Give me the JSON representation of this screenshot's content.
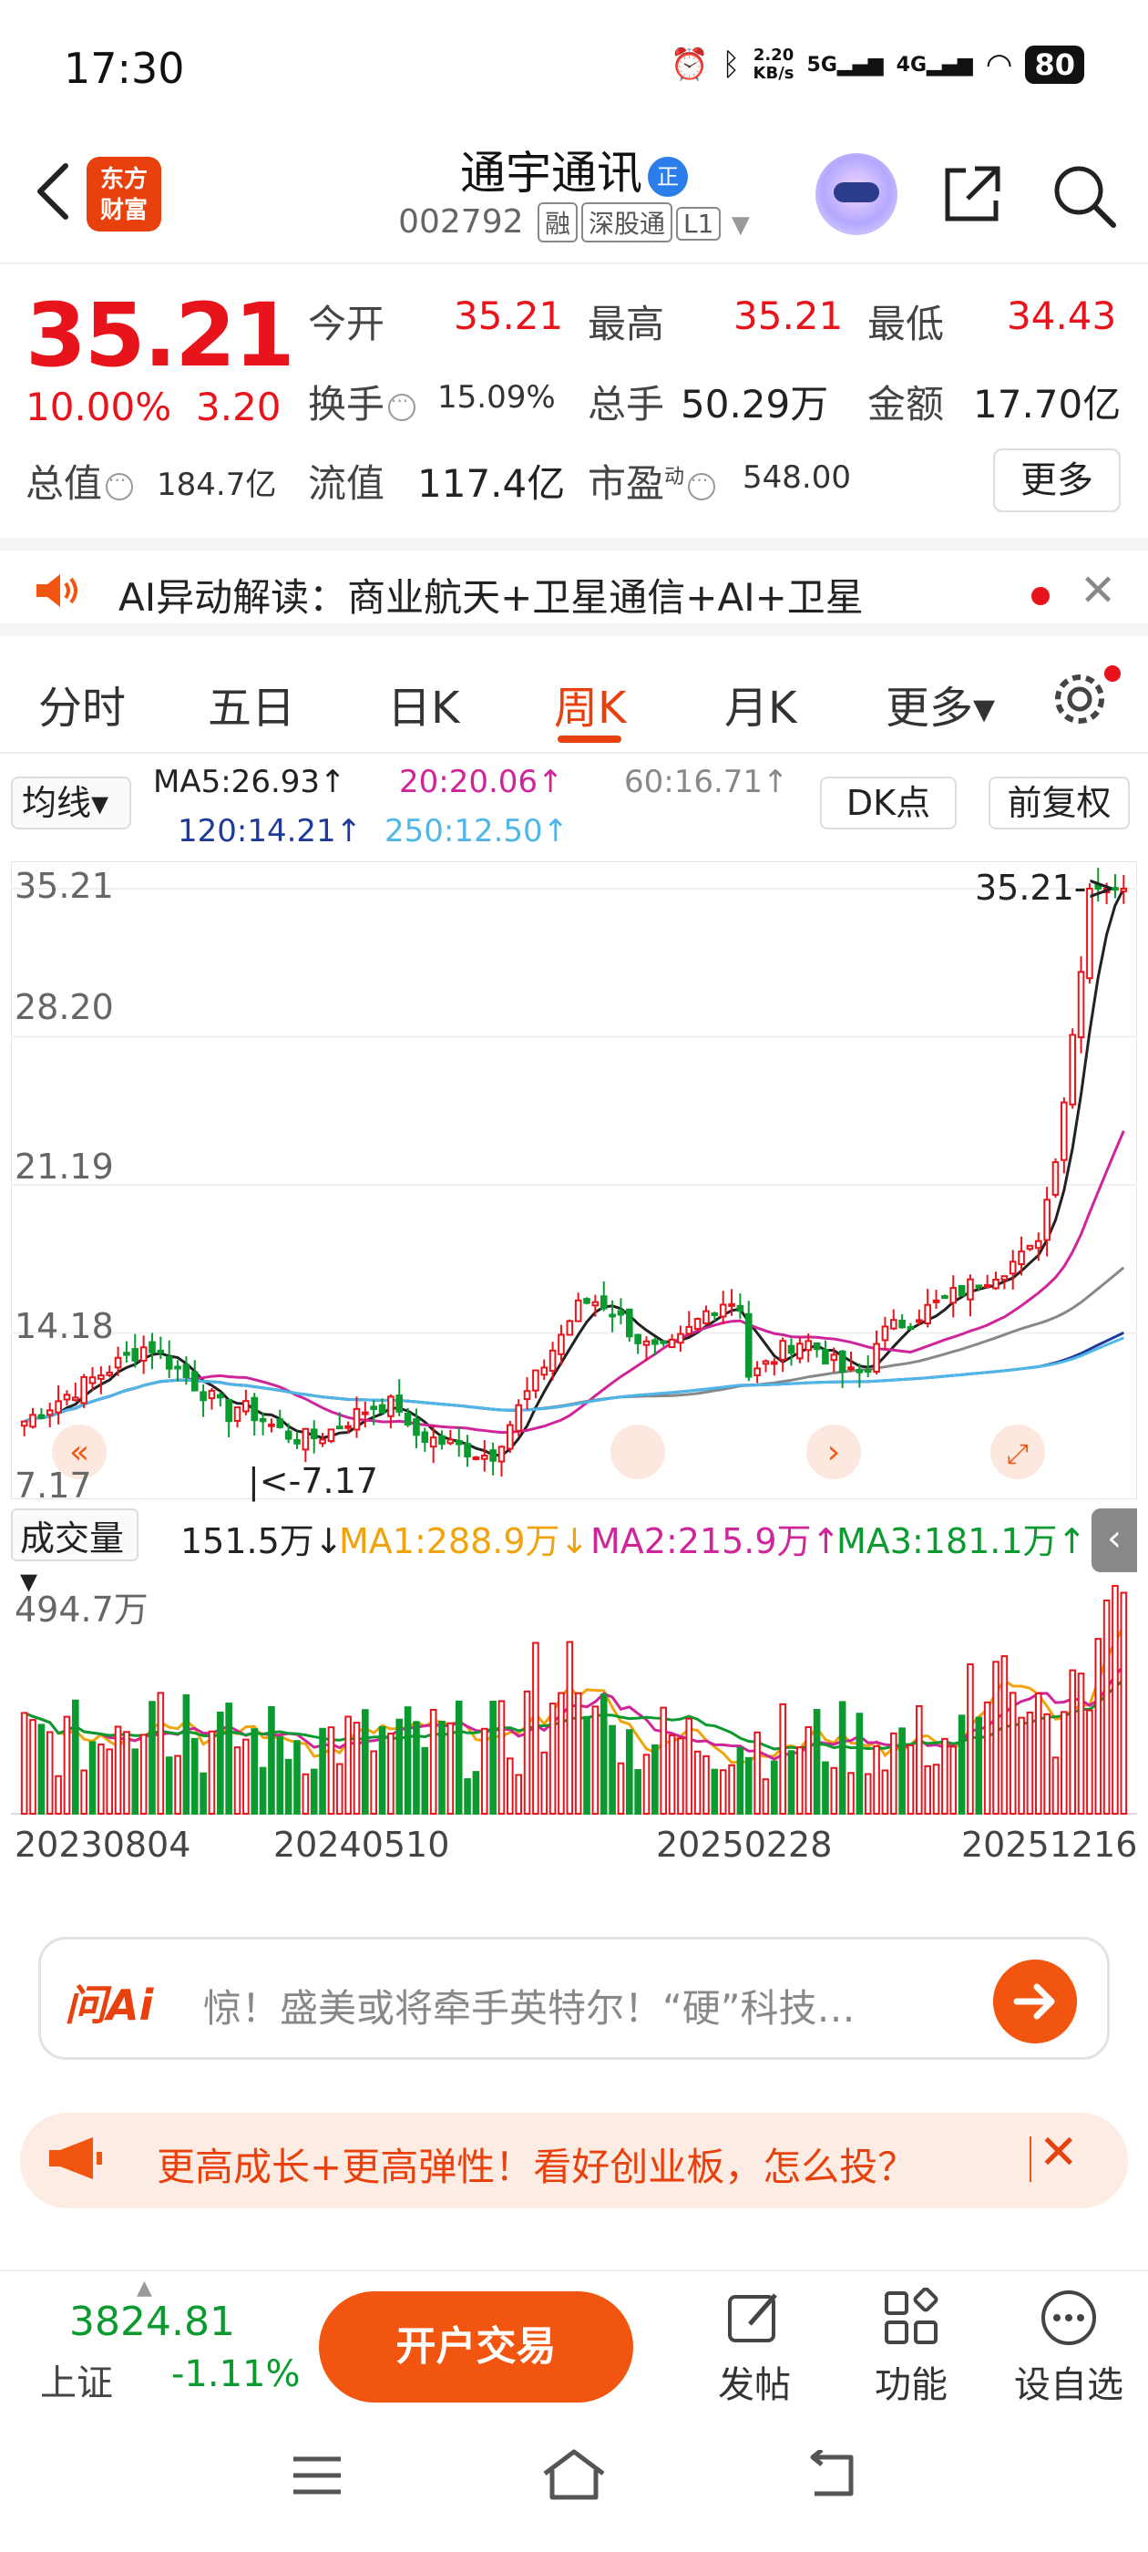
{
  "status_bar": {
    "time": "17:30",
    "speed_top": "2.20",
    "speed_bottom": "KB/s",
    "signal1": "5G",
    "signal2": "4G",
    "battery": "80"
  },
  "header": {
    "logo_line1": "东方",
    "logo_line2": "财富",
    "stock_name": "通宇通讯",
    "badge": "正",
    "code": "002792",
    "tags": [
      "融",
      "深股通",
      "L1"
    ]
  },
  "quote": {
    "price": "35.21",
    "change_pct": "10.00%",
    "change_abs": "3.20",
    "open_label": "今开",
    "open": "35.21",
    "high_label": "最高",
    "high": "35.21",
    "low_label": "最低",
    "low": "34.43",
    "turnover_label": "换手",
    "turnover": "15.09%",
    "volume_label": "总手",
    "volume": "50.29万",
    "amount_label": "金额",
    "amount": "17.70亿",
    "mktcap_label": "总值",
    "mktcap": "184.7亿",
    "float_label": "流值",
    "float": "117.4亿",
    "pe_label": "市盈",
    "pe_sup": "动",
    "pe": "548.00",
    "more": "更多"
  },
  "ai_banner": {
    "text": "AI异动解读：商业航天+卫星通信+AI+卫星"
  },
  "tabs": [
    {
      "label": "分时"
    },
    {
      "label": "五日"
    },
    {
      "label": "日K"
    },
    {
      "label": "周K"
    },
    {
      "label": "月K"
    },
    {
      "label": "更多▾"
    }
  ],
  "ma_legend": {
    "selector": "均线▾",
    "ma5": "MA5:26.93↑",
    "ma20": "20:20.06↑",
    "ma60": "60:16.71↑",
    "ma120": "120:14.21↑",
    "ma250": "250:12.50↑",
    "dk": "DK点",
    "adjust": "前复权",
    "colors": {
      "ma5": "#222222",
      "ma20": "#d0259a",
      "ma60": "#888888",
      "ma120": "#1f3a9a",
      "ma250": "#4fb7e8"
    }
  },
  "kchart": {
    "y_labels": [
      "35.21",
      "28.20",
      "21.19",
      "14.18",
      "7.17"
    ],
    "last_price_tag": "35.21->",
    "low_tag": "|<-7.17"
  },
  "volume": {
    "selector": "成交量▾",
    "vol": "151.5万↓",
    "ma1": "MA1:288.9万↓",
    "ma2": "MA2:215.9万↑",
    "ma3": "MA3:181.1万↑",
    "max_label": "494.7万",
    "colors": {
      "ma1": "#f0a30a",
      "ma2": "#d0259a",
      "ma3": "#0b9a2f"
    }
  },
  "dates": [
    "20230804",
    "20240510",
    "20250228",
    "20251216"
  ],
  "ask_bar": {
    "logo": "问Ai",
    "text": "惊！盛美或将牵手英特尔！“硬”科技…"
  },
  "promo": {
    "text": "更高成长+更高弹性！看好创业板，怎么投？"
  },
  "bottom_bar": {
    "index_value": "3824.81",
    "index_name": "上证",
    "index_change": "-1.11%",
    "open_button": "开户交易",
    "items": [
      {
        "label": "发帖"
      },
      {
        "label": "功能"
      },
      {
        "label": "设自选"
      }
    ]
  },
  "chart_data": {
    "type": "candlestick",
    "title": "",
    "ylim": [
      7.17,
      35.21
    ],
    "series": [
      {
        "name": "MA5",
        "values": [
          26.93
        ]
      },
      {
        "name": "20",
        "values": [
          20.06
        ]
      },
      {
        "name": "60",
        "values": [
          16.71
        ]
      },
      {
        "name": "120",
        "values": [
          14.21
        ]
      },
      {
        "name": "250",
        "values": [
          12.5
        ]
      }
    ]
  }
}
